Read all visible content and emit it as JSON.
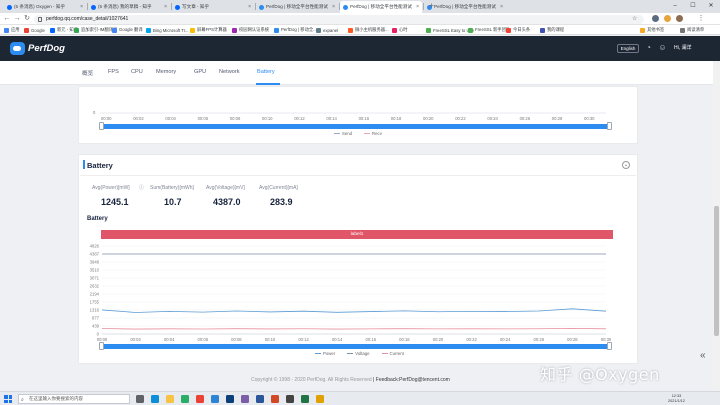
{
  "browser": {
    "tabs": [
      {
        "label": "(5 条消息) Oxygen - 知乎",
        "color": "#0066ff",
        "active": false
      },
      {
        "label": "(5 条消息) 我的草稿 - 知乎",
        "color": "#0066ff",
        "active": false
      },
      {
        "label": "写文章 - 知乎",
        "color": "#0066ff",
        "active": false
      },
      {
        "label": "PerfDog | 移动全平台性能测试",
        "color": "#2d8cf0",
        "active": false
      },
      {
        "label": "PerfDog | 移动全平台性能测试",
        "color": "#2d8cf0",
        "active": true
      },
      {
        "label": "PerfDog | 移动全平台性能测试",
        "color": "#2d8cf0",
        "active": false
      }
    ],
    "new_tab": "+",
    "window_controls": {
      "minimize": "–",
      "maximize": "☐",
      "close": "✕"
    },
    "url": "perfdog.qq.com/case_detail/1027641",
    "bookmarks": [
      {
        "label": "应用",
        "color": "#4285f4"
      },
      {
        "label": "Google",
        "color": "#ea4335"
      },
      {
        "label": "新元 - 知乎",
        "color": "#0066ff"
      },
      {
        "label": "追加索引-IM翻译板",
        "color": "#34a853"
      },
      {
        "label": "Google 翻译",
        "color": "#4285f4"
      },
      {
        "label": "Bing Microsoft Tr...",
        "color": "#00a4ef"
      },
      {
        "label": "屏幕FPS计算器",
        "color": "#fbbc05"
      },
      {
        "label": "校园网认证系统",
        "color": "#9c27b0"
      },
      {
        "label": "PerfDog | 移动全...",
        "color": "#2d8cf0"
      },
      {
        "label": "expanel",
        "color": "#607d8b"
      },
      {
        "label": "微小主机服务器...",
        "color": "#ff5722"
      },
      {
        "label": "心时",
        "color": "#e91e63"
      },
      {
        "label": "FreeSSL Easy to Use",
        "color": "#4caf50"
      },
      {
        "label": "FreeSSL 新手团队",
        "color": "#4caf50"
      },
      {
        "label": "今日头条",
        "color": "#f44336"
      },
      {
        "label": "我的课程",
        "color": "#3f51b5"
      },
      {
        "label": "其他书签",
        "color": "#f9a825"
      },
      {
        "label": "阅读清单",
        "color": "#757575"
      }
    ]
  },
  "app": {
    "logo": "PerfDog",
    "lang_button": "English",
    "user": "Hi, 澜洋",
    "nav": [
      "概览",
      "FPS",
      "CPU",
      "Memory",
      "GPU",
      "Network",
      "Battery"
    ],
    "active_nav": "Battery"
  },
  "network_chart": {
    "y_zero": "0",
    "legend": [
      {
        "name": "Send",
        "color": "#98a9c8"
      },
      {
        "name": "Recv",
        "color": "#e3a7b0"
      }
    ]
  },
  "time_axis": [
    "00:00",
    "00:02",
    "00:04",
    "00:06",
    "00:08",
    "00:10",
    "00:12",
    "00:14",
    "00:16",
    "00:18",
    "00:20",
    "00:22",
    "00:24",
    "00:26",
    "00:28",
    "00:30"
  ],
  "battery": {
    "section_title": "Battery",
    "collapse_icon": "⌄",
    "metrics": [
      {
        "label": "Avg(Power)[mW]",
        "value": "1245.1"
      },
      {
        "label": "Sum(Battery)[mWh]",
        "value": "10.7"
      },
      {
        "label": "Avg(Voltage)[mV]",
        "value": "4387.0"
      },
      {
        "label": "Avg(Current)[mA]",
        "value": "283.9"
      }
    ],
    "chart_title": "Battery",
    "label_band": "label1",
    "colors": {
      "power": "#5b9bd5",
      "voltage": "#7d8fa8",
      "current": "#e88f9b",
      "band": "#e05668",
      "accent": "#2d8cf0"
    }
  },
  "chart_data": {
    "type": "line",
    "title": "Battery",
    "y_ticks": [
      "0",
      "439",
      "877",
      "1316",
      "1755",
      "2194",
      "2632",
      "3071",
      "3510",
      "3948",
      "4387",
      "4826"
    ],
    "x": [
      "00:00",
      "00:02",
      "00:04",
      "00:06",
      "00:08",
      "00:10",
      "00:12",
      "00:14",
      "00:16",
      "00:18",
      "00:20",
      "00:22",
      "00:24",
      "00:26",
      "00:28",
      "00:30"
    ],
    "ylim": [
      0,
      4826
    ],
    "series": [
      {
        "name": "Power",
        "values": [
          1320,
          1180,
          1240,
          1200,
          1260,
          1210,
          1250,
          1190,
          1230,
          1270,
          1220,
          1240,
          1230,
          1260,
          1380,
          1250
        ]
      },
      {
        "name": "Voltage",
        "values": [
          4387,
          4387,
          4387,
          4387,
          4387,
          4387,
          4387,
          4387,
          4387,
          4387,
          4387,
          4387,
          4387,
          4387,
          4387,
          4387
        ]
      },
      {
        "name": "Current",
        "values": [
          300,
          270,
          285,
          275,
          290,
          278,
          286,
          272,
          282,
          292,
          280,
          284,
          281,
          288,
          310,
          284
        ]
      }
    ]
  },
  "footer": {
    "copyright": "Copyright © 1998 - 2020 PerfDog. All Rights Reserved",
    "feedback": "Feedback:PerfDog@tencent.com"
  },
  "watermark": "知乎 @Oxygen",
  "taskbar": {
    "search_placeholder": "在这里输入你要搜索的内容",
    "time": "12:33",
    "date": "2021/1/12",
    "icons": [
      {
        "name": "task-view-icon",
        "color": "#5f6368"
      },
      {
        "name": "edge-icon",
        "color": "#0c8fd6"
      },
      {
        "name": "file-explorer-icon",
        "color": "#f6c343"
      },
      {
        "name": "wechat-icon",
        "color": "#2aae67"
      },
      {
        "name": "chrome-icon",
        "color": "#ea4335"
      },
      {
        "name": "vscode-icon",
        "color": "#2b84d4"
      },
      {
        "name": "app-icon-7",
        "color": "#0a3f7a"
      },
      {
        "name": "app-icon-8",
        "color": "#7b5ea7"
      },
      {
        "name": "word-icon",
        "color": "#2b579a"
      },
      {
        "name": "powerpoint-icon",
        "color": "#d24726"
      },
      {
        "name": "app-icon-11",
        "color": "#444"
      },
      {
        "name": "excel-icon",
        "color": "#217346"
      },
      {
        "name": "app-icon-13",
        "color": "#e0a100"
      }
    ]
  }
}
